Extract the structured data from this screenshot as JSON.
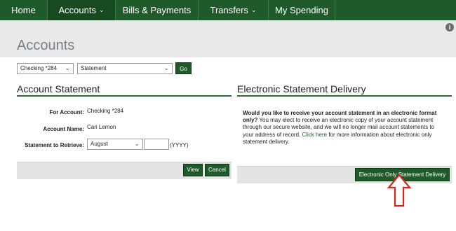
{
  "nav": {
    "home": "Home",
    "accounts": "Accounts",
    "bills": "Bills & Payments",
    "transfers": "Transfers",
    "spending": "My Spending"
  },
  "page": {
    "title": "Accounts"
  },
  "selectors": {
    "account": "Checking *284",
    "document": "Statement",
    "go": "Go"
  },
  "account_statement": {
    "heading": "Account Statement",
    "for_account_label": "For Account:",
    "for_account_value": "Checking *284",
    "account_name_label": "Account Name:",
    "account_name_value": "Cari Lemon",
    "retrieve_label": "Statement to Retrieve:",
    "month": "August",
    "year_value": "",
    "year_hint": "(YYYY)",
    "view": "View",
    "cancel": "Cancel"
  },
  "electronic": {
    "heading": "Electronic Statement Delivery",
    "question": "Would you like to receive your account statement in an electronic format only?",
    "body_1": "You may elect to receive an electronic copy of your account statement through our secure website, and we will no longer mail account statements to your address of record.",
    "link": "Click here",
    "body_2": "for more information about electronic only statement delivery.",
    "button": "Electronic Only Statement Delivery"
  },
  "annotation": {
    "arrow_color": "#d9251c"
  },
  "icons": {
    "info": "info-icon",
    "caret": "chevron-down-icon"
  }
}
